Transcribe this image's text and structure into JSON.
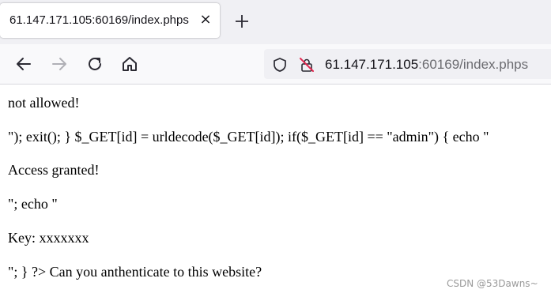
{
  "tab": {
    "title": "61.147.171.105:60169/index.phps",
    "close_glyph": "×"
  },
  "toolbar": {
    "icons": [
      "back-arrow-icon",
      "forward-arrow-icon",
      "reload-icon",
      "home-icon",
      "new-tab-plus-icon",
      "shield-icon",
      "insecure-lock-icon"
    ]
  },
  "address_bar": {
    "host": "61.147.171.105",
    "rest": ":60169/index.phps"
  },
  "page": {
    "lines": [
      "not allowed!",
      "\"); exit(); } $_GET[id] = urldecode($_GET[id]); if($_GET[id] == \"admin\") { echo \"",
      "Access granted!",
      "\"; echo \"",
      "Key: xxxxxxx",
      "\"; } ?> Can you anthenticate to this website?"
    ]
  },
  "watermark": "CSDN @53Dawns~"
}
